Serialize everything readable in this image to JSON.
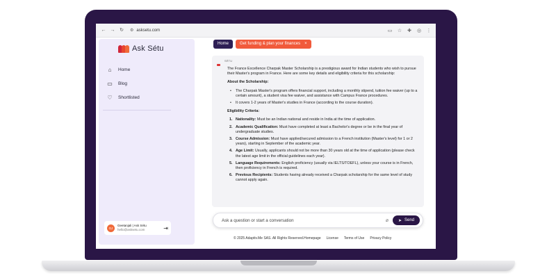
{
  "browser": {
    "url": "asksetu.com",
    "back_icon": "arrow-left-icon",
    "forward_icon": "arrow-right-icon",
    "reload_icon": "reload-icon"
  },
  "sidebar": {
    "brand": "Ask Sétu",
    "items": [
      {
        "label": "Home",
        "icon": "home-icon"
      },
      {
        "label": "Blog",
        "icon": "monitor-icon"
      },
      {
        "label": "Shortlisted",
        "icon": "heart-icon"
      }
    ],
    "user": {
      "initials": "GJ",
      "name": "Geetanjali | Ask Sétu",
      "email": "hello@asksetu.com"
    }
  },
  "chips": {
    "home": "Home",
    "funding": "Get funding & plan your finances",
    "close": "×"
  },
  "answer": {
    "author": "SĒTU",
    "intro": "The France Excellence Charpak Master Scholarship is a prestigious award for Indian students who wish to pursue their Master's program in France. Here are some key details and eligibility criteria for this scholarship:",
    "about_heading": "About the Scholarship:",
    "about_items": [
      "The Charpak Master's program offers financial support, including a monthly stipend, tuition fee waiver (up to a certain amount), a student visa fee waiver, and assistance with Campus France procedures.",
      "It covers 1-2 years of Master's studies in France (according to the course duration)."
    ],
    "eligibility_heading": "Eligibility Criteria:",
    "eligibility_items": [
      {
        "num": "1.",
        "title": "Nationality:",
        "text": " Must be an Indian national and reside in India at the time of application."
      },
      {
        "num": "2.",
        "title": "Academic Qualification:",
        "text": " Must have completed at least a Bachelor's degree or be in the final year of undergraduate studies."
      },
      {
        "num": "3.",
        "title": "Course Admission:",
        "text": " Must have applied/secured admission to a French institution (Master's level) for 1 or 2 years), starting in September of the academic year."
      },
      {
        "num": "4.",
        "title": "Age Limit:",
        "text": " Usually, applicants should not be more than 30 years old at the time of application (please check the latest age limit in the official guidelines each year)."
      },
      {
        "num": "5.",
        "title": "Language Requirements:",
        "text": " English proficiency (usually via IELTS/TOEFL), unless your course is in French, then proficiency in French is required."
      },
      {
        "num": "6.",
        "title": "Previous Recipients:",
        "text": " Students having already received a Charpak scholarship for the same level of study cannot apply again."
      }
    ]
  },
  "composer": {
    "placeholder": "Ask a question or start a conversation",
    "send_label": "Send"
  },
  "footer": {
    "copyright": "© 2025 Adaptiv.Me SAS. All Rights Reserved.",
    "links": [
      "Homepage",
      "License",
      "Terms of Use",
      "Privacy Policy"
    ]
  },
  "colors": {
    "frame": "#2a1646",
    "accent": "#f15a3b",
    "sidebar_bg": "#efebfb"
  }
}
